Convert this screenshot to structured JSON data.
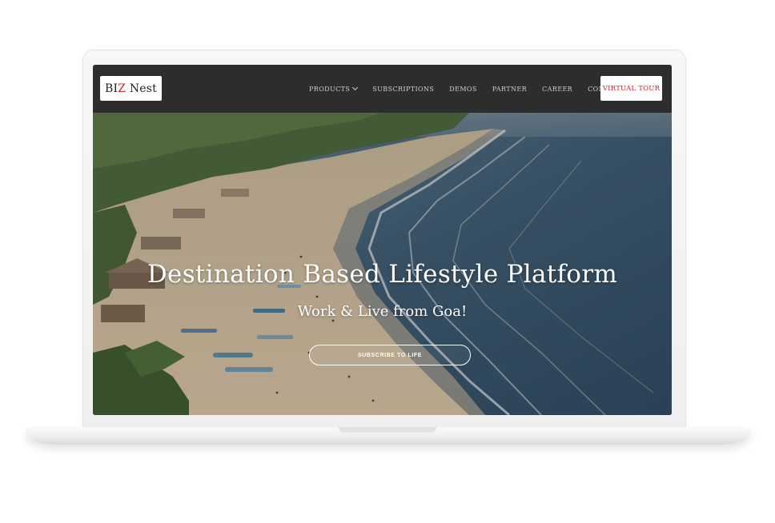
{
  "logo": {
    "part1": "BI",
    "part2": "Z",
    "part3": " Nest"
  },
  "nav": {
    "items": [
      {
        "label": "PRODUCTS",
        "has_dropdown": true
      },
      {
        "label": "SUBSCRIPTIONS"
      },
      {
        "label": "DEMOS"
      },
      {
        "label": "PARTNER"
      },
      {
        "label": "CAREER"
      },
      {
        "label": "CONTACT"
      }
    ],
    "cta_label": "VIRTUAL TOUR"
  },
  "hero": {
    "title": "Destination Based Lifestyle Platform",
    "subtitle": "Work & Live from Goa!",
    "button_label": "SUBSCRIBE TO LIFE"
  },
  "colors": {
    "navbar_bg": "#2d2d2d",
    "brand_red": "#d0202b",
    "sea": "#3e5c73",
    "sand": "#d9c3a2"
  },
  "icons": {
    "dropdown": "chevron-down-icon"
  }
}
